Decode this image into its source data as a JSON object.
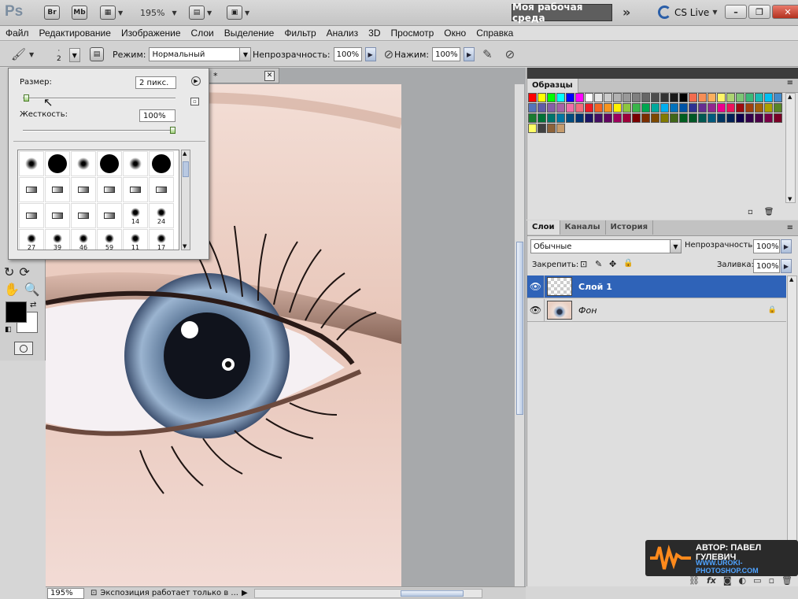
{
  "titlebar": {
    "logo": "Ps",
    "bridge_label": "Br",
    "minibridge_label": "Mb",
    "zoom": "195%",
    "workspace": "Моя рабочая среда",
    "more": "»",
    "cslive": "CS Live",
    "window_buttons": {
      "minimize": "–",
      "restore": "❐",
      "close": "✕"
    }
  },
  "menu": [
    "Файл",
    "Редактирование",
    "Изображение",
    "Слои",
    "Выделение",
    "Фильтр",
    "Анализ",
    "3D",
    "Просмотр",
    "Окно",
    "Справка"
  ],
  "options": {
    "brush_size": "2",
    "mode_label": "Режим:",
    "mode_value": "Нормальный",
    "opacity_label": "Непрозрачность:",
    "opacity_value": "100%",
    "pressure_label": "Нажим:",
    "pressure_value": "100%"
  },
  "brush_popup": {
    "size_label": "Размер:",
    "size_value": "2 пикс.",
    "size_level": 0.02,
    "hardness_label": "Жесткость:",
    "hardness_value": "100%",
    "hardness_level": 1.0,
    "presets": [
      {
        "shape": "soft",
        "label": ""
      },
      {
        "shape": "hard",
        "label": ""
      },
      {
        "shape": "soft",
        "label": ""
      },
      {
        "shape": "hard",
        "label": ""
      },
      {
        "shape": "soft",
        "label": ""
      },
      {
        "shape": "hard",
        "label": ""
      },
      {
        "shape": "pen",
        "label": ""
      },
      {
        "shape": "pen",
        "label": ""
      },
      {
        "shape": "pen",
        "label": ""
      },
      {
        "shape": "pen",
        "label": ""
      },
      {
        "shape": "pen",
        "label": ""
      },
      {
        "shape": "pen",
        "label": ""
      },
      {
        "shape": "pen",
        "label": ""
      },
      {
        "shape": "pen",
        "label": ""
      },
      {
        "shape": "pen",
        "label": ""
      },
      {
        "shape": "pen",
        "label": ""
      },
      {
        "shape": "splat",
        "label": "14"
      },
      {
        "shape": "splat",
        "label": "24"
      },
      {
        "shape": "splat",
        "label": "27"
      },
      {
        "shape": "splat",
        "label": "39"
      },
      {
        "shape": "splat",
        "label": "46"
      },
      {
        "shape": "splat",
        "label": "59"
      },
      {
        "shape": "splat",
        "label": "11"
      },
      {
        "shape": "splat",
        "label": "17"
      }
    ]
  },
  "document": {
    "tab_mark": "*",
    "tab_close": "✕",
    "zoom": "195%",
    "status": "Экспозиция работает только в ..."
  },
  "swatches": {
    "tab": "Образцы",
    "colors": [
      "#ff0000",
      "#ffff00",
      "#00ff00",
      "#00ffff",
      "#0000ff",
      "#ff00ff",
      "#ffffff",
      "#e6e6e6",
      "#cccccc",
      "#b3b3b3",
      "#999999",
      "#808080",
      "#666666",
      "#4d4d4d",
      "#333333",
      "#1a1a1a",
      "#000000",
      "#f26c4f",
      "#f68e56",
      "#fbaf5d",
      "#fff568",
      "#acd372",
      "#7cc576",
      "#3bb878",
      "#1abbb4",
      "#00bff3",
      "#438ccb",
      "#5574b9",
      "#605ca8",
      "#855fa8",
      "#a763a8",
      "#f06ea9",
      "#f26d7d",
      "#ed1c24",
      "#f26522",
      "#f7941d",
      "#fff200",
      "#8dc63f",
      "#39b54a",
      "#00a651",
      "#00a99d",
      "#00aeef",
      "#0072bc",
      "#0054a6",
      "#2e3192",
      "#662d91",
      "#92278f",
      "#ec008c",
      "#ed145b",
      "#9e0b0f",
      "#a0410d",
      "#a36209",
      "#aba000",
      "#598527",
      "#1a7b30",
      "#007236",
      "#00746b",
      "#0076a3",
      "#004b80",
      "#003471",
      "#1b1464",
      "#440e62",
      "#630460",
      "#9e005d",
      "#9e0039",
      "#790000",
      "#7b2e00",
      "#7d4900",
      "#827b00",
      "#406618",
      "#005e20",
      "#005826",
      "#005952",
      "#005b7f",
      "#003663",
      "#002157",
      "#0d004c",
      "#32004b",
      "#4b0049",
      "#7b0046",
      "#7a0026",
      "#ffff66",
      "#404040",
      "#8c6239",
      "#c69c6d"
    ]
  },
  "layers": {
    "tabs": [
      "Слои",
      "Каналы",
      "История"
    ],
    "blend_mode": "Обычные",
    "opacity_label": "Непрозрачность:",
    "opacity_value": "100%",
    "lock_label": "Закрепить:",
    "fill_label": "Заливка:",
    "fill_value": "100%",
    "items": [
      {
        "name": "Слой 1",
        "selected": true,
        "thumb": "transparent"
      },
      {
        "name": "Фон",
        "selected": false,
        "thumb": "eye",
        "locked": true
      }
    ]
  },
  "watermark": {
    "author": "АВТОР: ПАВЕЛ ГУЛЕВИЧ",
    "site": "WWW.UROKI-PHOTOSHOP.COM"
  }
}
